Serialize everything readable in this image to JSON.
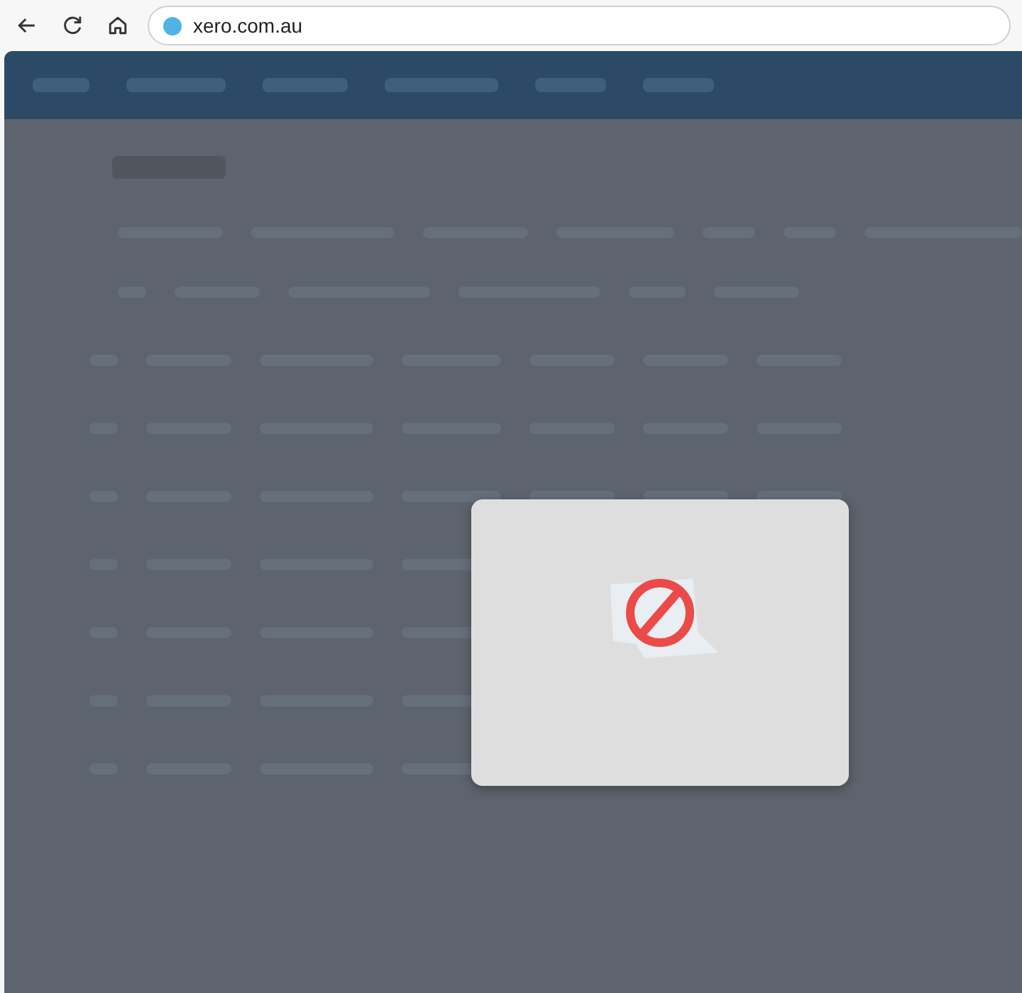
{
  "browser": {
    "url": "xero.com.au"
  }
}
